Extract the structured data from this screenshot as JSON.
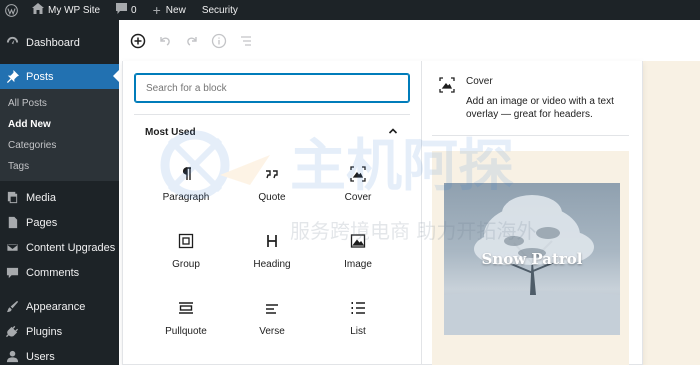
{
  "admin_bar": {
    "site_name": "My WP Site",
    "comments_count": "0",
    "new_label": "New",
    "security_label": "Security"
  },
  "sidebar": {
    "items": [
      {
        "label": "Dashboard",
        "icon": "dashboard-icon"
      },
      {
        "label": "Posts",
        "icon": "pin-icon",
        "active": true
      },
      {
        "label": "Media",
        "icon": "media-icon"
      },
      {
        "label": "Pages",
        "icon": "pages-icon"
      },
      {
        "label": "Content Upgrades",
        "icon": "mail-icon"
      },
      {
        "label": "Comments",
        "icon": "comment-icon"
      },
      {
        "label": "Appearance",
        "icon": "brush-icon"
      },
      {
        "label": "Plugins",
        "icon": "plug-icon"
      },
      {
        "label": "Users",
        "icon": "user-icon"
      }
    ],
    "posts_submenu": [
      "All Posts",
      "Add New",
      "Categories",
      "Tags"
    ]
  },
  "toolbar": {
    "buttons": [
      "add-block-icon",
      "undo-icon",
      "redo-icon",
      "info-icon",
      "outline-icon"
    ]
  },
  "inserter": {
    "search_placeholder": "Search for a block",
    "section_title": "Most Used",
    "blocks": [
      {
        "label": "Paragraph",
        "icon": "paragraph-icon"
      },
      {
        "label": "Quote",
        "icon": "quote-icon"
      },
      {
        "label": "Cover",
        "icon": "cover-icon"
      },
      {
        "label": "Group",
        "icon": "group-icon"
      },
      {
        "label": "Heading",
        "icon": "heading-icon"
      },
      {
        "label": "Image",
        "icon": "image-icon"
      },
      {
        "label": "Pullquote",
        "icon": "pullquote-icon"
      },
      {
        "label": "Verse",
        "icon": "verse-icon"
      },
      {
        "label": "List",
        "icon": "list-icon"
      }
    ]
  },
  "preview": {
    "title": "Cover",
    "description": "Add an image or video with a text overlay — great for headers.",
    "caption": "Snow Patrol"
  },
  "watermark": {
    "brand_text": "主机阿探",
    "tagline": "服务跨境电商 助力开拓海外"
  },
  "colors": {
    "admin_dark": "#1d2327",
    "accent_blue": "#2271b1",
    "focus_blue": "#007cba",
    "preview_bg": "#f8f1e4"
  }
}
